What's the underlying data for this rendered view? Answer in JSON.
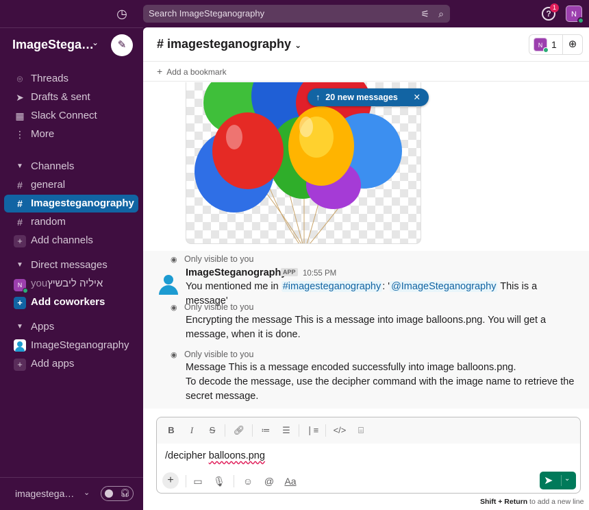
{
  "topbar": {
    "search_placeholder": "Search ImageSteganography",
    "help_badge": "1",
    "avatar_initial": "N"
  },
  "sidebar": {
    "workspace": "ImageStega…",
    "items": [
      {
        "label": "Threads"
      },
      {
        "label": "Drafts & sent"
      },
      {
        "label": "Slack Connect"
      },
      {
        "label": "More"
      }
    ],
    "channels_header": "Channels",
    "channels": [
      "general",
      "Imagesteganography",
      "random"
    ],
    "add_channels": "Add channels",
    "dm_header": "Direct messages",
    "dm_user": "איליה ליבשיץ",
    "dm_you": "you",
    "add_coworkers": "Add coworkers",
    "apps_header": "Apps",
    "app_name": "ImageSteganography",
    "add_apps": "Add apps",
    "footer_workspace": "imagesteganography"
  },
  "channel": {
    "title": "# imagesteganography",
    "member_count": "1",
    "member_initial": "N",
    "add_bookmark": "Add a bookmark"
  },
  "banner": {
    "label": "20 new messages"
  },
  "messages": {
    "only_visible": "Only visible to you",
    "sender": "ImageSteganography",
    "app_badge": "APP",
    "time": "10:55 PM",
    "m1_prefix": "You mentioned me in ",
    "m1_channel": "#imagesteganography",
    "m1_mid": ": '",
    "m1_mention": "@ImageSteganography",
    "m1_suffix": " This is  a message'",
    "m2": "Encrypting the message This is  a message into image balloons.png. You will get a message, when it is done.",
    "m3_line1": "Message This is  a message encoded successfully into image balloons.png.",
    "m3_line2": "To decode the message, use the decipher command with the image name to retrieve the secret message."
  },
  "composer": {
    "cmd": "/decipher ",
    "arg": "balloons.png",
    "hint_keys": "Shift + Return",
    "hint_rest": " to add a new line"
  },
  "colors": {
    "aubergine": "#3f0e40",
    "active_blue": "#1164a3",
    "send_green": "#007a5a",
    "mention_bg": "#e8f5fa"
  }
}
